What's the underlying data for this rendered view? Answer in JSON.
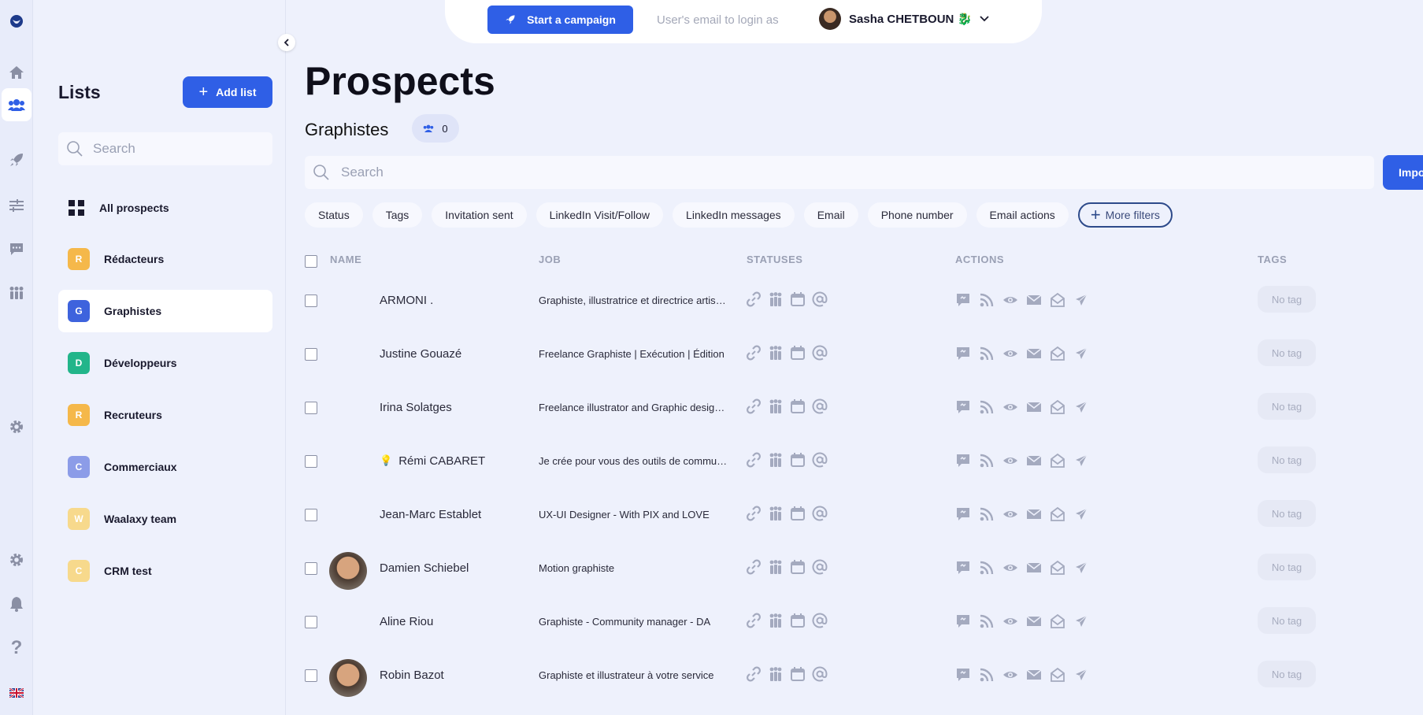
{
  "topbar": {
    "start_campaign_label": "Start a campaign",
    "login_as_placeholder": "User's email to login as",
    "user_name": "Sasha CHETBOUN 🐉"
  },
  "rail": {
    "items": [
      "logo-icon",
      "home-icon",
      "users-icon",
      "rocket-icon",
      "list-icon",
      "chat-icon",
      "team-icon",
      "gear-icon",
      "gear-icon",
      "bell-icon",
      "help-icon",
      "uk-flag-icon"
    ]
  },
  "sidebar": {
    "title": "Lists",
    "add_list_label": "Add list",
    "search_placeholder": "Search",
    "all_prospects_label": "All prospects",
    "lists": [
      {
        "letter": "R",
        "label": "Rédacteurs",
        "color": "#f5b84a"
      },
      {
        "letter": "G",
        "label": "Graphistes",
        "color": "#3e63dd"
      },
      {
        "letter": "D",
        "label": "Développeurs",
        "color": "#22b58a"
      },
      {
        "letter": "R",
        "label": "Recruteurs",
        "color": "#f5b84a"
      },
      {
        "letter": "C",
        "label": "Commerciaux",
        "color": "#8c9ce8"
      },
      {
        "letter": "W",
        "label": "Waalaxy team",
        "color": "#f7d98c"
      },
      {
        "letter": "C",
        "label": "CRM test",
        "color": "#f7d98c"
      }
    ],
    "active_index": 1
  },
  "main": {
    "page_title": "Prospects",
    "list_name": "Graphistes",
    "member_count": "0",
    "search_placeholder": "Search",
    "import_label": "Impo",
    "filters": [
      "Status",
      "Tags",
      "Invitation sent",
      "LinkedIn Visit/Follow",
      "LinkedIn messages",
      "Email",
      "Phone number",
      "Email actions"
    ],
    "more_filters_label": "More filters",
    "columns": {
      "name": "NAME",
      "job": "JOB",
      "statuses": "STATUSES",
      "actions": "ACTIONS",
      "tags": "TAGS"
    },
    "rows": [
      {
        "name": "ARMONI .",
        "job": "Graphiste, illustratrice et directrice artistique",
        "avatar": false,
        "tag": "No tag"
      },
      {
        "name": "Justine Gouazé",
        "job": "Freelance Graphiste | Exécution | Édition",
        "avatar": false,
        "tag": "No tag"
      },
      {
        "name": "Irina Solatges",
        "job": "Freelance illustrator and Graphic designer",
        "avatar": false,
        "tag": "No tag"
      },
      {
        "name": "Rémi CABARET",
        "prefix": "💡",
        "job": "Je crée pour vous des outils de communication",
        "avatar": false,
        "tag": "No tag"
      },
      {
        "name": "Jean-Marc Establet",
        "job": "UX-UI Designer - With PIX and LOVE",
        "avatar": false,
        "tag": "No tag"
      },
      {
        "name": "Damien Schiebel",
        "job": "Motion graphiste",
        "avatar": true,
        "tag": "No tag"
      },
      {
        "name": "Aline Riou",
        "job": "Graphiste - Community manager - DA",
        "avatar": false,
        "tag": "No tag"
      },
      {
        "name": "Robin Bazot",
        "job": "Graphiste et illustrateur à votre service",
        "avatar": true,
        "tag": "No tag"
      }
    ],
    "status_icons": [
      "link-icon",
      "people-icon",
      "calendar-icon",
      "at-icon"
    ],
    "action_icons": [
      "message-icon",
      "rss-icon",
      "eye-icon",
      "mail-icon",
      "mail-open-icon",
      "send-icon"
    ]
  },
  "colors": {
    "accent": "#2f5fe6",
    "background": "#eef1fc",
    "icon_muted": "#a4aabf"
  }
}
